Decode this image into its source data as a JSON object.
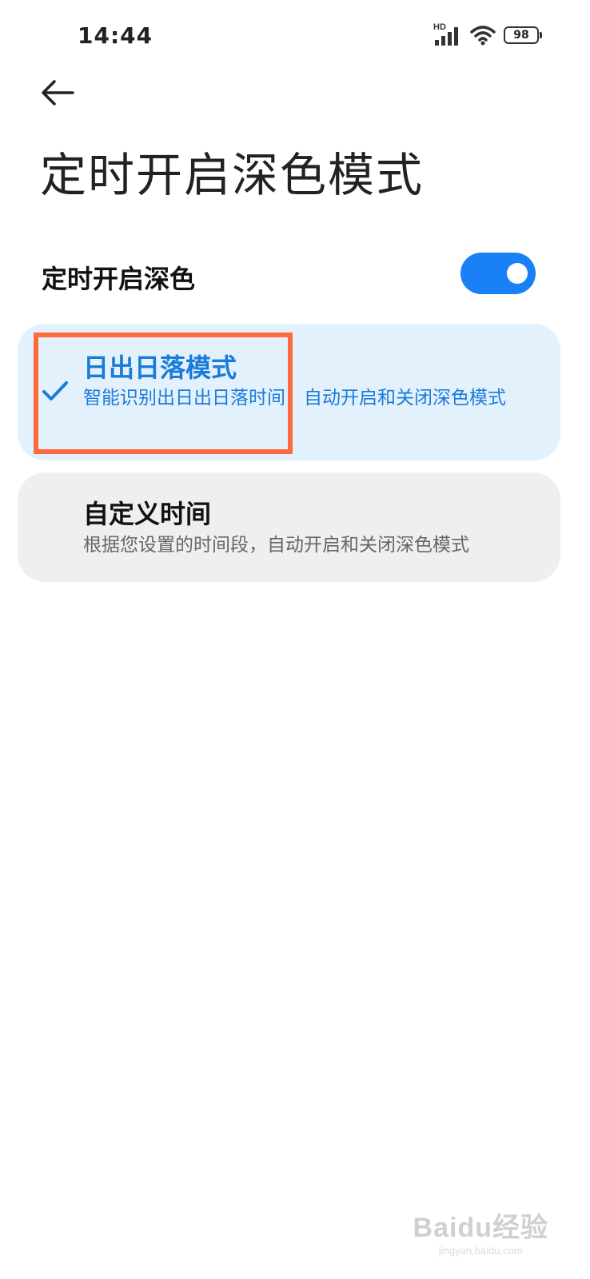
{
  "status_bar": {
    "time": "14:44",
    "network_label": "HD",
    "battery_level": "98",
    "icons": [
      "signal-icon",
      "wifi-icon",
      "battery-icon"
    ]
  },
  "header": {
    "back_icon": "back-arrow-icon",
    "title": "定时开启深色模式"
  },
  "schedule_toggle": {
    "label": "定时开启深色",
    "enabled": true,
    "accent_color": "#1a80f5"
  },
  "options": [
    {
      "title": "日出日落模式",
      "description": "智能识别出日出日落时间，自动开启和关闭深色模式",
      "selected": true,
      "icon": "checkmark-icon",
      "color": "#1a7bd9"
    },
    {
      "title": "自定义时间",
      "description": "根据您设置的时间段，自动开启和关闭深色模式",
      "selected": false
    }
  ],
  "annotation": {
    "highlight_color": "#ff6a3d"
  },
  "watermark": {
    "brand": "Baidu经验",
    "url": "jingyan.baidu.com"
  }
}
